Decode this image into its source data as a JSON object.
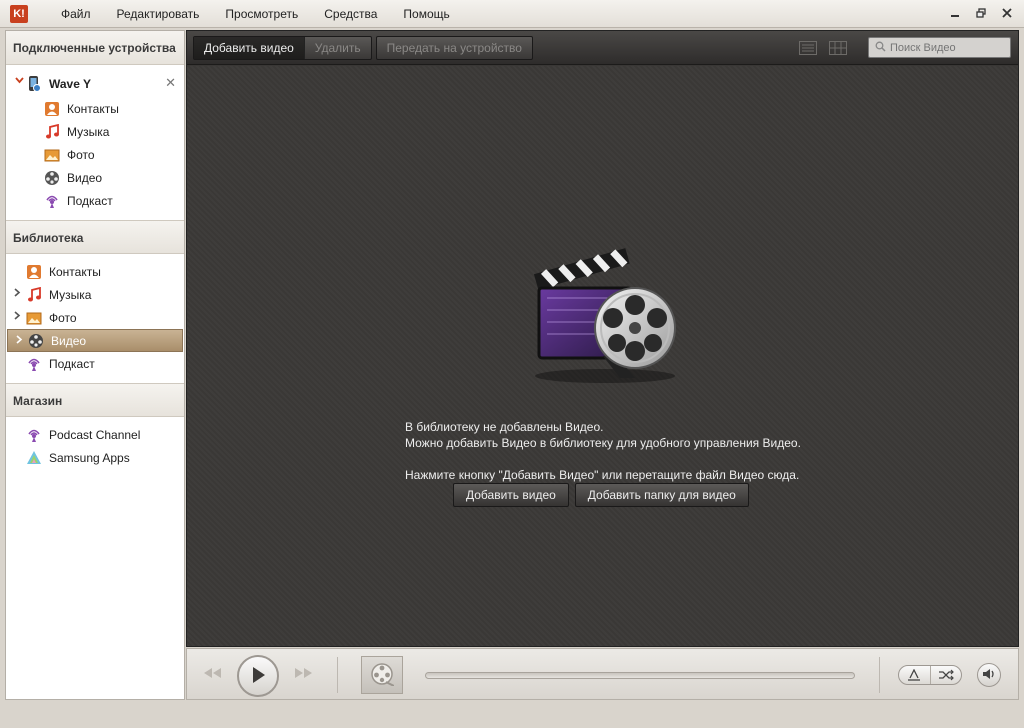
{
  "menu": {
    "logo": "K!",
    "items": [
      "Файл",
      "Редактировать",
      "Просмотреть",
      "Средства",
      "Помощь"
    ]
  },
  "sidebar": {
    "devices_header": "Подключенные устройства",
    "device": {
      "name": "Wave Y",
      "items": [
        "Контакты",
        "Музыка",
        "Фото",
        "Видео",
        "Подкаст"
      ]
    },
    "library_header": "Библиотека",
    "library_items": [
      "Контакты",
      "Музыка",
      "Фото",
      "Видео",
      "Подкаст"
    ],
    "store_header": "Магазин",
    "store_items": [
      "Podcast Channel",
      "Samsung Apps"
    ]
  },
  "toolbar": {
    "add_video": "Добавить видео",
    "delete": "Удалить",
    "send_to_device": "Передать на устройство",
    "search_placeholder": "Поиск Видео"
  },
  "empty_state": {
    "line1": "В библиотеку не добавлены Видео.",
    "line2": "Можно добавить Видео в библиотеку для удобного управления Видео.",
    "line3": "Нажмите кнопку \"Добавить Видео\" или перетащите файл Видео сюда.",
    "btn_add_video": "Добавить видео",
    "btn_add_folder": "Добавить папку для видео"
  },
  "colors": {
    "accent": "#c8401e",
    "selected_row": "#b09a78",
    "content_bg": "#3a3836"
  }
}
